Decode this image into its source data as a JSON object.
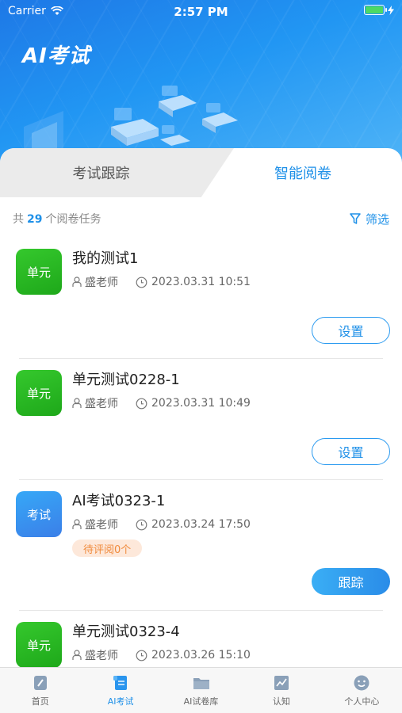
{
  "status_bar": {
    "carrier": "Carrier",
    "time": "2:57 PM"
  },
  "brand": "AI考试",
  "tabs": [
    {
      "label": "考试跟踪",
      "active": false
    },
    {
      "label": "智能阅卷",
      "active": true
    }
  ],
  "summary": {
    "prefix": "共",
    "count": "29",
    "suffix": "个阅卷任务"
  },
  "filter_label": "筛选",
  "tasks": [
    {
      "badge": "单元",
      "title": "我的测试1",
      "teacher": "盛老师",
      "datetime": "2023.03.31 10:51",
      "action": "设置"
    },
    {
      "badge": "单元",
      "title": "单元测试0228-1",
      "teacher": "盛老师",
      "datetime": "2023.03.31 10:49",
      "action": "设置"
    },
    {
      "badge": "考试",
      "title": "AI考试0323-1",
      "teacher": "盛老师",
      "datetime": "2023.03.24 17:50",
      "pending": "待评阅0个",
      "action": "跟踪"
    },
    {
      "badge": "单元",
      "title": "单元测试0323-4",
      "teacher": "盛老师",
      "datetime": "2023.03.26 15:10"
    }
  ],
  "nav": [
    {
      "label": "首页",
      "icon": "home-icon",
      "active": false
    },
    {
      "label": "AI考试",
      "icon": "exam-icon",
      "active": true
    },
    {
      "label": "AI试卷库",
      "icon": "folder-icon",
      "active": false
    },
    {
      "label": "认知",
      "icon": "chart-icon",
      "active": false
    },
    {
      "label": "个人中心",
      "icon": "smile-icon",
      "active": false
    }
  ],
  "colors": {
    "accent": "#1e90e8",
    "green_badge": "#1ea81a",
    "blue_badge": "#3b7fe8",
    "pending_bg": "#fde8da",
    "pending_text": "#f08a3c"
  }
}
